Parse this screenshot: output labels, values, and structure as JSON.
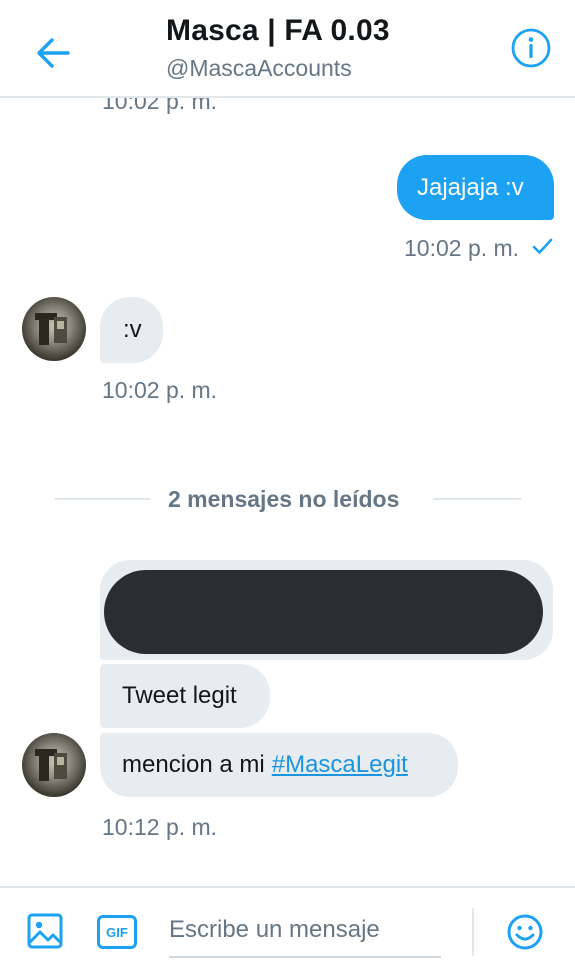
{
  "header": {
    "title": "Masca | FA 0.03",
    "handle": "@MascaAccounts",
    "back_icon": "arrow-left-icon",
    "info_icon": "info-circle-icon"
  },
  "messages": {
    "top_timestamp": "10:02 p. m.",
    "sent_text": "Jajajaja :v",
    "sent_timestamp": "10:02 p. m.",
    "received_1_text": ":v",
    "received_1_timestamp": "10:02 p. m.",
    "unread_divider": "2 mensajes no leídos",
    "received_2_text": "Tweet legit",
    "received_3_text": "mencion a mi",
    "received_3_hashtag": "#MascaLegit",
    "received_3_timestamp": "10:12 p. m."
  },
  "composer": {
    "placeholder": "Escribe un mensaje",
    "gif_label": "GIF",
    "image_icon": "image-icon",
    "emoji_icon": "emoji-icon"
  },
  "colors": {
    "accent": "#1da1f2",
    "received_bubble": "#e6ecf0",
    "muted_text": "#657786"
  }
}
